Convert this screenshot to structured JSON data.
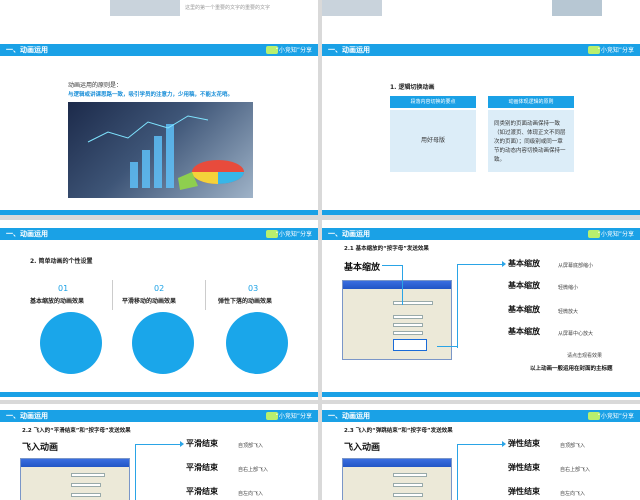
{
  "slides": {
    "s1": {
      "header": "一、动画运用",
      "tag": "“小竞知”分享",
      "heading": "动画运用的原则是：",
      "sub": "与逻辑或讲课思路一致，吸引学员的注意力，少用稿，不能太花哨。",
      "top_text": "这里的第一个重要的文字的重要的文字"
    },
    "s2": {
      "header": "一、动画运用",
      "tag": "“小竞知”分享",
      "title": "1. 逻辑切换动画",
      "left_head": "段落内容切换的要点",
      "right_head": "动画体现逻辑的原则",
      "left_body": "用好母版",
      "right_body": "同类别的页面动画保持一致（如过渡页、体现正文不同层次的页面）；同级别或同一章节的动态内容切换动画保持一致。"
    },
    "s3": {
      "header": "一、动画运用",
      "tag": "“小竞知”分享",
      "title": "2. 简单动画的个性设置",
      "items": [
        {
          "num": "01",
          "label": "基本缩放的动画效果"
        },
        {
          "num": "02",
          "label": "平滑移动的动画效果"
        },
        {
          "num": "03",
          "label": "弹性下落的动画效果"
        }
      ]
    },
    "s4": {
      "header": "一、动画运用",
      "tag": "“小竞知”分享",
      "title": "2.1 基本缩放的“按字母”发送效果",
      "main_label": "基本缩放",
      "rows": [
        {
          "label": "基本缩放",
          "note": "从屏幕底部缩小"
        },
        {
          "label": "基本缩放",
          "note": "轻微缩小"
        },
        {
          "label": "基本缩放",
          "note": "轻微放大"
        },
        {
          "label": "基本缩放",
          "note": "从屏幕中心放大"
        }
      ],
      "hint": "请点击观看效果",
      "footer_note": "以上动画一般运用在封面的主标题"
    },
    "s5": {
      "header": "一、动画运用",
      "tag": "“小竞知”分享",
      "title": "2.2 飞入的“平滑结束”和“按字母”发送效果",
      "main_label": "飞入动画",
      "rows": [
        {
          "label": "平滑结束",
          "note": "自顶部飞入"
        },
        {
          "label": "平滑结束",
          "note": "自右上部飞入"
        },
        {
          "label": "平滑结束",
          "note": "自左向飞入"
        }
      ]
    },
    "s6": {
      "header": "一、动画运用",
      "tag": "“小竞知”分享",
      "title": "2.3 飞入的“弹跳结束”和“按字母”发送效果",
      "main_label": "飞入动画",
      "rows": [
        {
          "label": "弹性结束",
          "note": "自顶部飞入"
        },
        {
          "label": "弹性结束",
          "note": "自右上部飞入"
        },
        {
          "label": "弹性结束",
          "note": "自左向飞入"
        }
      ]
    }
  },
  "colors": {
    "accent": "#1aa1e6",
    "badge": "#b8f06e",
    "heading_blue": "#1a8fd8"
  }
}
